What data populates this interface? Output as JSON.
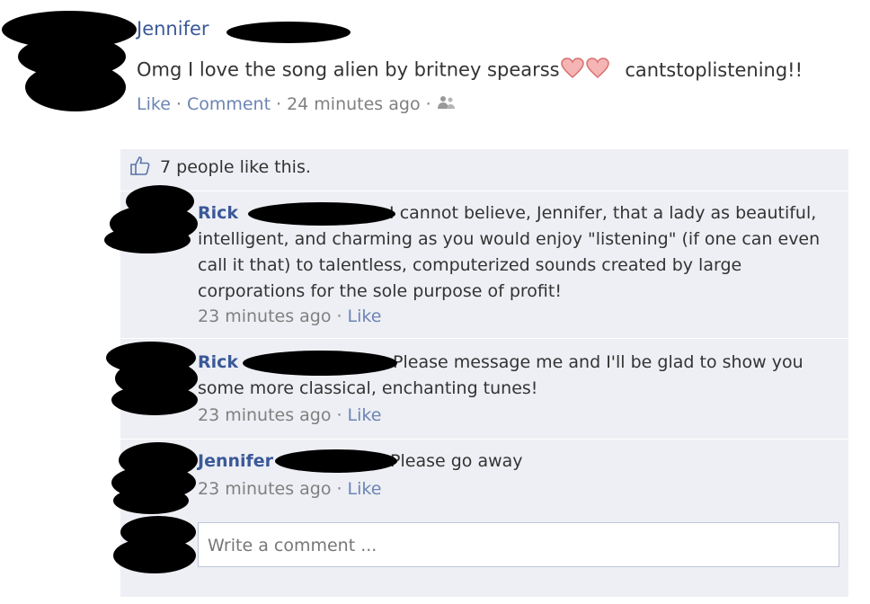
{
  "post": {
    "author": "Jennifer",
    "text_before": "Omg I love the song alien by britney spearss",
    "text_after": "cantstoplistening!!",
    "actions": {
      "like": "Like",
      "comment": "Comment",
      "sep": "·"
    },
    "time": "24 minutes ago",
    "audience_icon": "friends-icon"
  },
  "likes": {
    "text": "7 people like this.",
    "icon": "thumbs-up-icon"
  },
  "comments": [
    {
      "author": "Rick",
      "text": "I cannot believe, Jennifer, that a lady as beautiful, intelligent, and charming as you would enjoy \"listening\" (if one can even call it that) to talentless, computerized sounds created by large corporations for the sole purpose of profit!",
      "time": "23 minutes ago",
      "like": "Like"
    },
    {
      "author": "Rick",
      "text": "Please message me and I'll be glad to show you some more classical, enchanting tunes!",
      "time": "23 minutes ago",
      "like": "Like"
    },
    {
      "author": "Jennifer",
      "text": "Please go away",
      "time": "23 minutes ago",
      "like": "Like"
    }
  ],
  "composer": {
    "placeholder": "Write a comment ..."
  },
  "colors": {
    "link": "#3b5998",
    "panel": "#edeff4",
    "meta": "#808080",
    "heart": "#f28a8a"
  }
}
